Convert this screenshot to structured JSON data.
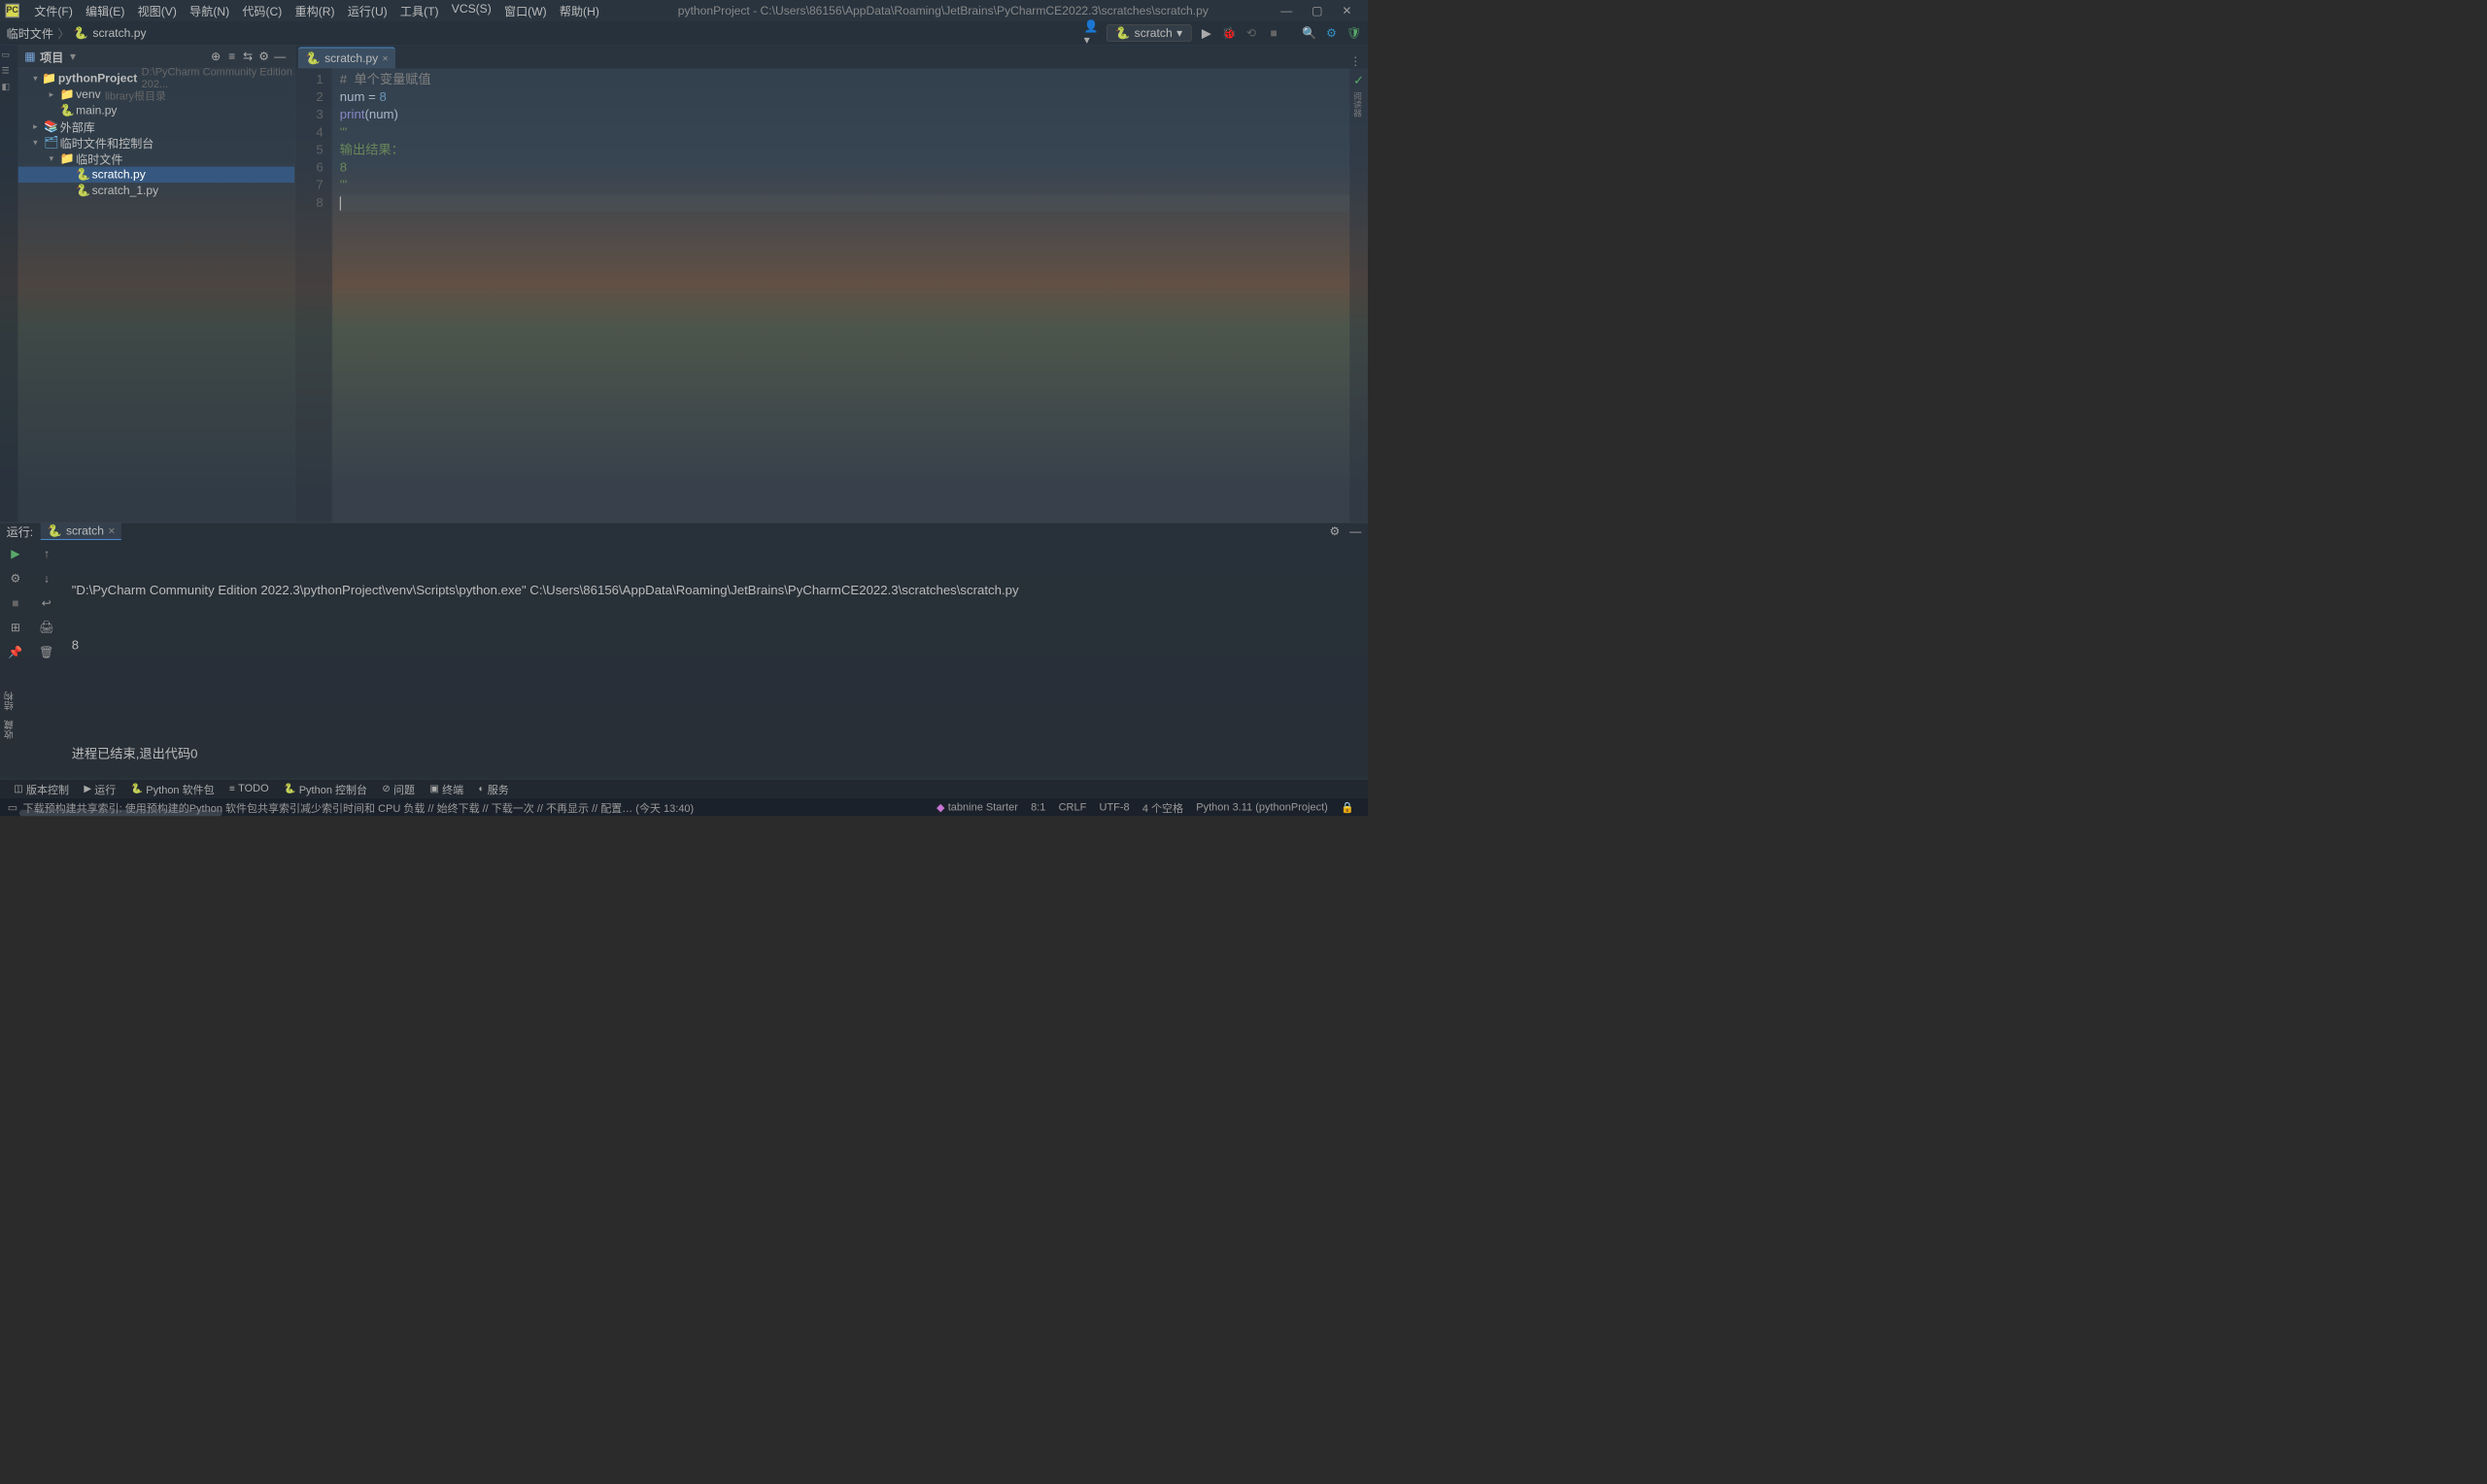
{
  "titlebar": {
    "menus": [
      "文件(F)",
      "编辑(E)",
      "视图(V)",
      "导航(N)",
      "代码(C)",
      "重构(R)",
      "运行(U)",
      "工具(T)",
      "VCS(S)",
      "窗口(W)",
      "帮助(H)"
    ],
    "title": "pythonProject - C:\\Users\\86156\\AppData\\Roaming\\JetBrains\\PyCharmCE2022.3\\scratches\\scratch.py"
  },
  "navbar": {
    "breadcrumb": [
      "临时文件",
      "scratch.py"
    ],
    "run_config": "scratch"
  },
  "project_panel": {
    "title": "项目",
    "tree": {
      "root_name": "pythonProject",
      "root_path": "D:\\PyCharm Community Edition 202...",
      "venv": {
        "name": "venv",
        "hint": "library根目录"
      },
      "main": "main.py",
      "external": "外部库",
      "scratch_root": "临时文件和控制台",
      "scratch_folder": "临时文件",
      "scratch_files": [
        "scratch.py",
        "scratch_1.py"
      ]
    }
  },
  "editor": {
    "tab_name": "scratch.py",
    "lines": [
      {
        "n": 1,
        "tokens": [
          [
            "comment",
            "#  单个变量赋值"
          ]
        ]
      },
      {
        "n": 2,
        "tokens": [
          [
            "ident",
            "num "
          ],
          [
            "op",
            "= "
          ],
          [
            "num",
            "8"
          ]
        ]
      },
      {
        "n": 3,
        "tokens": [
          [
            "builtin",
            "print"
          ],
          [
            "op",
            "("
          ],
          [
            "ident",
            "num"
          ],
          [
            "op",
            ")"
          ]
        ]
      },
      {
        "n": 4,
        "tokens": [
          [
            "str",
            "'''"
          ]
        ]
      },
      {
        "n": 5,
        "tokens": [
          [
            "str",
            "输出结果："
          ]
        ]
      },
      {
        "n": 6,
        "tokens": [
          [
            "str",
            "8"
          ]
        ]
      },
      {
        "n": 7,
        "tokens": [
          [
            "str",
            "'''"
          ]
        ]
      },
      {
        "n": 8,
        "tokens": []
      }
    ],
    "current_line": 8
  },
  "run_panel": {
    "label": "运行:",
    "tab": "scratch",
    "output_cmd": "\"D:\\PyCharm Community Edition 2022.3\\pythonProject\\venv\\Scripts\\python.exe\" C:\\Users\\86156\\AppData\\Roaming\\JetBrains\\PyCharmCE2022.3\\scratches\\scratch.py",
    "output_result": "8",
    "exit_msg": "进程已结束,退出代码0"
  },
  "vtabs": [
    "结构",
    "收藏"
  ],
  "bottom_bar": {
    "items": [
      "版本控制",
      "运行",
      "Python 软件包",
      "TODO",
      "Python 控制台",
      "问题",
      "终端",
      "服务"
    ]
  },
  "status_bar": {
    "msg": "下载预构建共享索引: 使用预构建的Python 软件包共享索引减少索引时间和 CPU 负载 // 始终下载 // 下载一次 // 不再显示 // 配置… (今天 13:40)",
    "tabnine": "tabnine Starter",
    "pos": "8:1",
    "line_ending": "CRLF",
    "encoding": "UTF-8",
    "indent": "4 个空格",
    "interpreter": "Python 3.11 (pythonProject)"
  }
}
